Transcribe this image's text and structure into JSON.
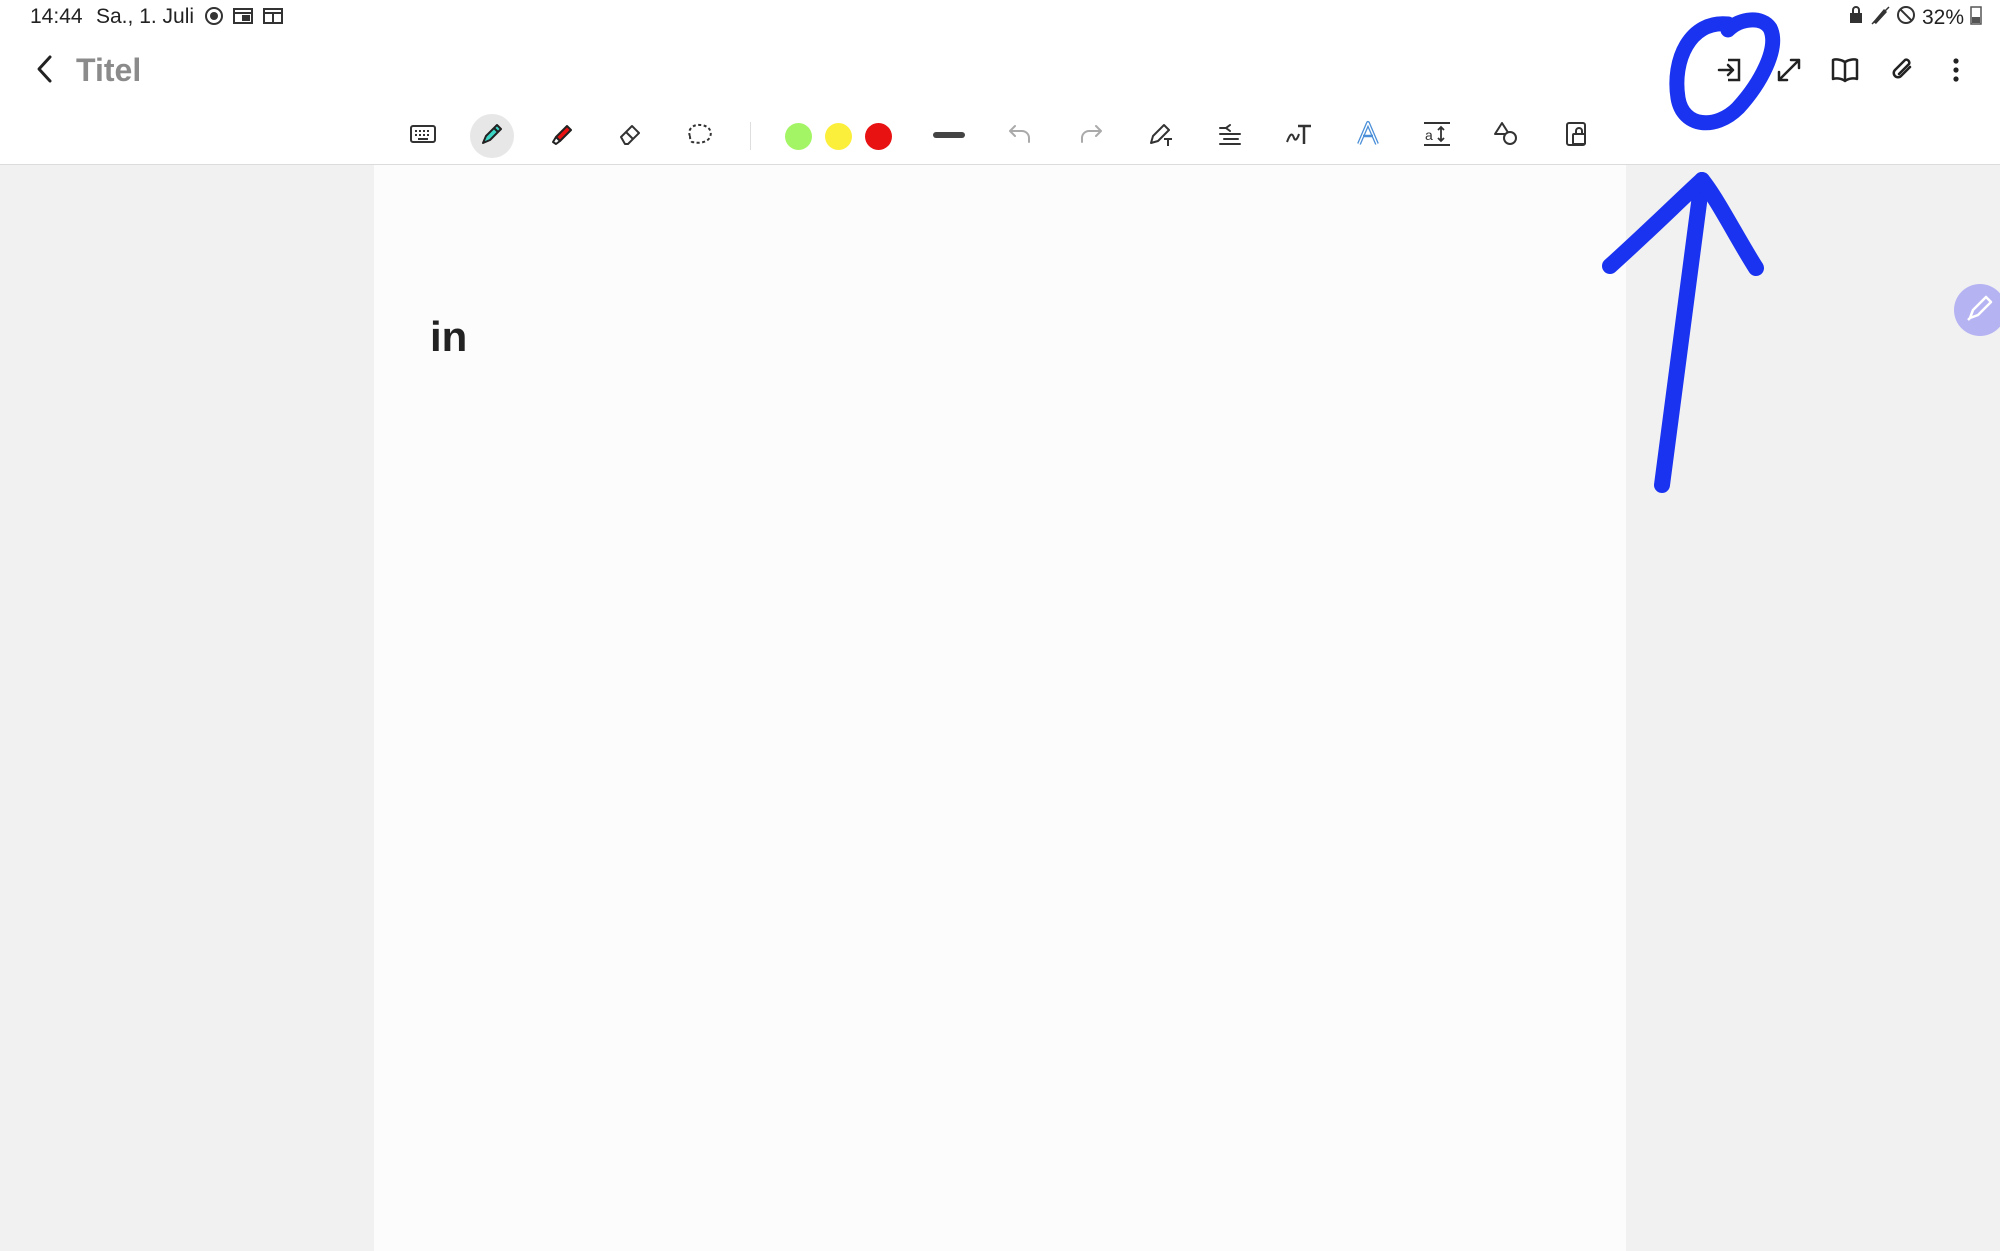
{
  "status_bar": {
    "time": "14:44",
    "date": "Sa., 1. Juli",
    "battery": "32%",
    "left_icons": [
      "record-icon",
      "window-icon",
      "calendar-icon"
    ],
    "right_icons": [
      "lock-icon",
      "pen-icon",
      "mute-icon",
      "battery-icon"
    ]
  },
  "header": {
    "back_icon": "chevron-left-icon",
    "title": "Titel",
    "actions": [
      "import-icon",
      "expand-icon",
      "book-icon",
      "attachment-icon",
      "more-vertical-icon"
    ]
  },
  "toolbar": {
    "tools": [
      "keyboard-icon",
      "pen-icon",
      "highlighter-icon",
      "eraser-icon",
      "lasso-icon"
    ],
    "active_tool": "pen-icon",
    "colors": [
      "#a4f566",
      "#fbef3b",
      "#e81212"
    ],
    "stroke": "line-thickness-icon",
    "history": [
      "undo-icon",
      "redo-icon"
    ],
    "extras": [
      "pen-settings-icon",
      "text-align-icon",
      "handwriting-to-text-icon",
      "text-style-icon",
      "text-size-icon",
      "shapes-icon",
      "lock-icon"
    ]
  },
  "note": {
    "content": "in"
  },
  "annotation": {
    "color": "#1a33f0"
  }
}
